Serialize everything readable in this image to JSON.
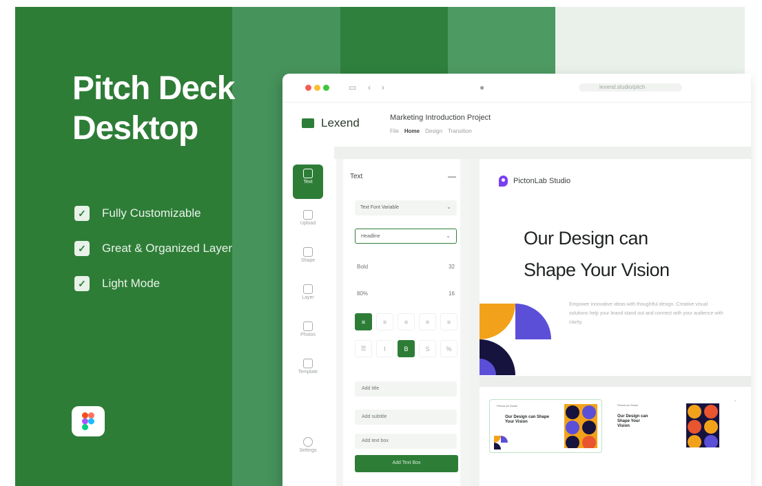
{
  "hero": {
    "title_line1": "Pitch Deck",
    "title_line2": "Desktop",
    "features": [
      "Fully Customizable",
      "Great & Organized Layer",
      "Light Mode"
    ]
  },
  "app": {
    "brand": "Lexend",
    "url": "lexend.studio/pitch",
    "project_title": "Marketing Introduction Project",
    "menu": [
      "File",
      "Home",
      "Design",
      "Transition"
    ],
    "active_menu": "Home",
    "nav": [
      "Text",
      "Upload",
      "Shape",
      "Layer",
      "Photos",
      "Template",
      "Settings"
    ],
    "panel": {
      "heading": "Text",
      "font_select": "Text Font Variable",
      "style_select": "Headline",
      "weight": "Bold",
      "size": "32",
      "spacing": "80%",
      "line": "16",
      "field1": "Add title",
      "field2": "Add subtitle",
      "field3": "Add text box",
      "button": "Add Text Box"
    }
  },
  "slide": {
    "studio": "PictonLab Studio",
    "headline_line1": "Our Design can",
    "headline_line2": "Shape Your Vision",
    "body": "Empower innovative ideas with thoughtful design. Creative visual solutions help your brand stand out and connect with your audience with clarity.",
    "thumb_title": "Our Design can Shape Your Vision",
    "thumb_brand": "PictonLab Studio"
  },
  "colors": {
    "primary_green": "#2e7d37",
    "accent_purple": "#5b4fd8",
    "accent_orange": "#f2a21a",
    "accent_navy": "#17133f"
  }
}
